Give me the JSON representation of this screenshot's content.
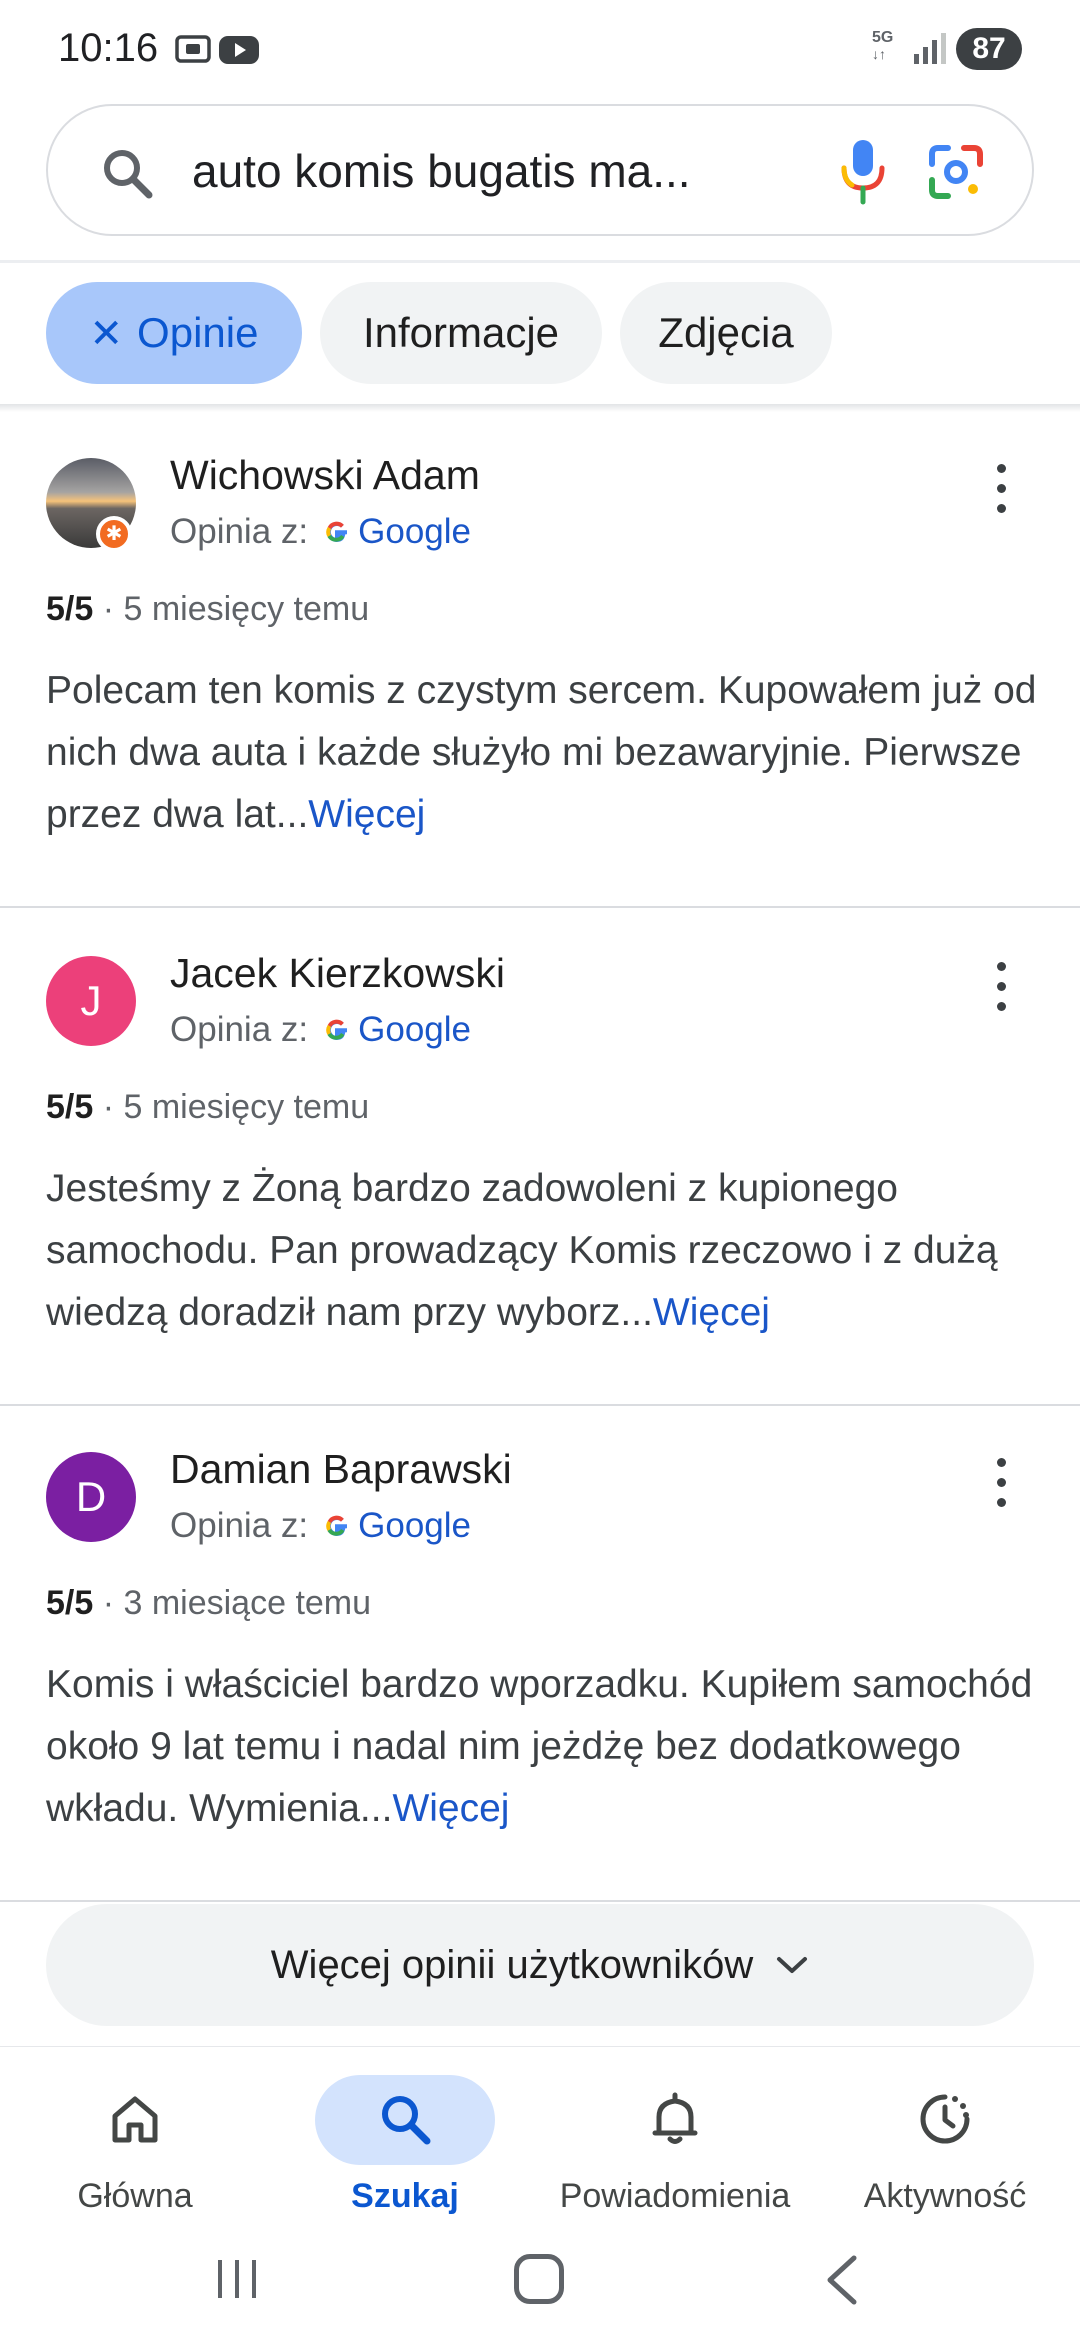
{
  "status_bar": {
    "time": "10:16",
    "network": "5G",
    "battery": "87",
    "icons": [
      "screenshot-icon",
      "youtube-icon",
      "signal-icon",
      "battery-icon"
    ]
  },
  "search": {
    "query": "auto komis bugatis ma...",
    "icons": [
      "search-icon",
      "mic-icon",
      "lens-icon"
    ]
  },
  "chips": [
    {
      "label": "Opinie",
      "active": true,
      "close_glyph": "✕"
    },
    {
      "label": "Informacje",
      "active": false
    },
    {
      "label": "Zdjęcia",
      "active": false
    }
  ],
  "reviews": [
    {
      "name": "Wichowski Adam",
      "avatar_letter": "",
      "avatar_color": "photo",
      "badge": "✱",
      "source_prefix": "Opinia z:",
      "source": "Google",
      "rating": "5/5",
      "date": "· 5 miesięcy temu",
      "text": "Polecam ten komis z czystym sercem. Kupowałem już od nich dwa auta i każde służyło mi bezawaryjnie. Pierwsze przez dwa lat...",
      "more": "Więcej"
    },
    {
      "name": "Jacek Kierzkowski",
      "avatar_letter": "J",
      "avatar_color": "#ec407a",
      "source_prefix": "Opinia z:",
      "source": "Google",
      "rating": "5/5",
      "date": "· 5 miesięcy temu",
      "text": "Jesteśmy z Żoną bardzo zadowoleni z kupionego samochodu. Pan prowadzący Komis rzeczowo i z dużą wiedzą doradził nam przy wyborz...",
      "more": "Więcej"
    },
    {
      "name": "Damian Baprawski",
      "avatar_letter": "D",
      "avatar_color": "#7b1fa2",
      "source_prefix": "Opinia z:",
      "source": "Google",
      "rating": "5/5",
      "date": "· 3 miesiące temu",
      "text": "Komis i właściciel bardzo wporzadku. Kupiłem samochód około 9 lat temu i nadal nim jeżdżę bez dodatkowego wkładu. Wymienia...",
      "more": "Więcej"
    }
  ],
  "more_reviews_label": "Więcej opinii użytkowników",
  "bottom_nav": [
    {
      "label": "Główna",
      "icon": "home-icon",
      "active": false
    },
    {
      "label": "Szukaj",
      "icon": "search-icon",
      "active": true
    },
    {
      "label": "Powiadomienia",
      "icon": "bell-icon",
      "active": false
    },
    {
      "label": "Aktywność",
      "icon": "activity-icon",
      "active": false
    }
  ],
  "system_nav": [
    "recent-apps-icon",
    "home-button-icon",
    "back-icon"
  ],
  "colors": {
    "accent": "#0b57d0",
    "chip_active_bg": "#a8c7fa",
    "link": "#1a56c8",
    "nav_active_pill": "#d3e3fd"
  }
}
